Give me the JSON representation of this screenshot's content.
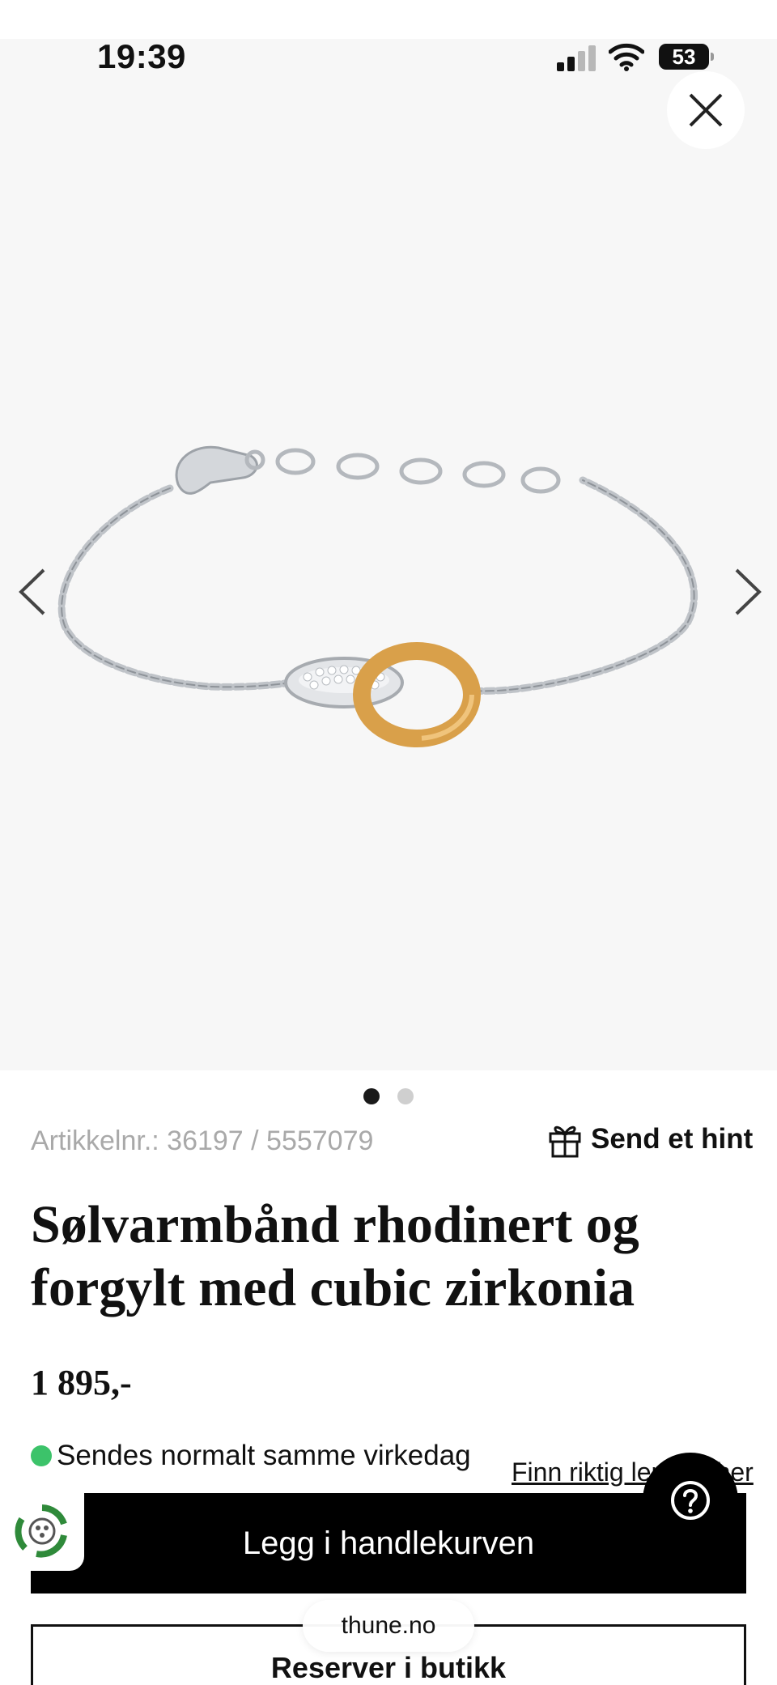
{
  "status_bar": {
    "time": "19:39",
    "battery": "53"
  },
  "gallery": {
    "image_alt": "Sølvarmbånd rhodinert og forgylt med cubic zirkonia",
    "slide_count": 2,
    "active_slide": 1,
    "close_icon": "close-icon",
    "prev_icon": "chevron-left-icon",
    "next_icon": "chevron-right-icon"
  },
  "product": {
    "article_number": "Artikkelnr.: 36197 / 5557079",
    "hint_label": "Send et hint",
    "title": "Sølvarmbånd rhodinert og forgylt med cubic zirkonia",
    "price": "1 895,-",
    "stock_text": "Sendes normalt samme virkedag",
    "size_link": "Finn riktig lengde her"
  },
  "actions": {
    "add_to_cart": "Legg i handlekurven",
    "reserve": "Reserver i butikk"
  },
  "browser": {
    "domain": "thune.no"
  },
  "colors": {
    "stock_green": "#3cc36a",
    "button_black": "#000000",
    "muted_gray": "#a9a9a9",
    "gold": "#d9a04a"
  }
}
